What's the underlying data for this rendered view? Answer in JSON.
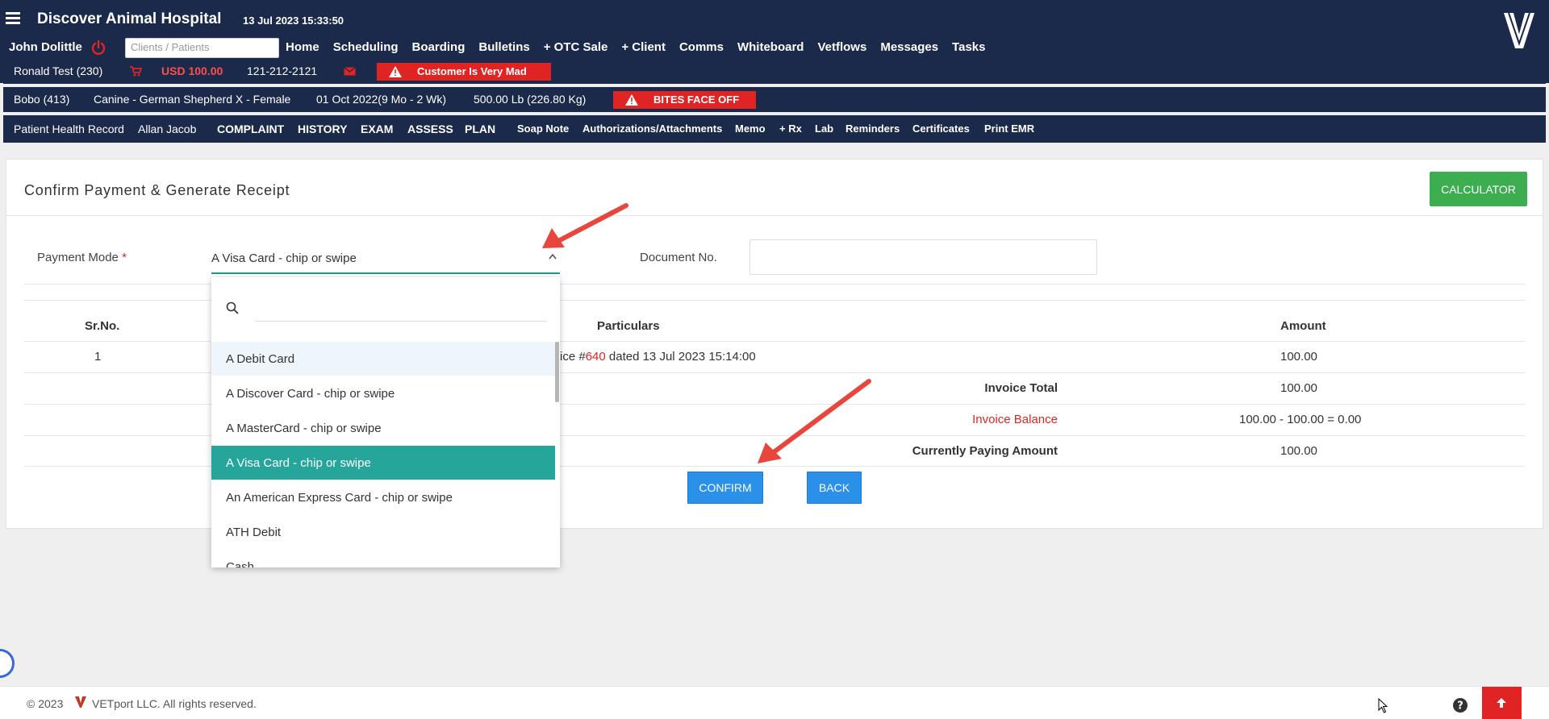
{
  "header": {
    "clinic_name": "Discover Animal Hospital",
    "datetime": "13 Jul 2023 15:33:50",
    "user_name": "John Dolittle",
    "search_placeholder": "Clients / Patients",
    "nav": [
      "Home",
      "Scheduling",
      "Boarding",
      "Bulletins",
      "+ OTC Sale",
      "+ Client",
      "Comms",
      "Whiteboard",
      "Vetflows",
      "Messages",
      "Tasks"
    ]
  },
  "client": {
    "name": "Ronald Test (230)",
    "balance": "USD 100.00",
    "phone": "121-212-2121",
    "alert": "Customer Is Very Mad"
  },
  "patient": {
    "name": "Bobo (413)",
    "breed": "Canine - German Shepherd X - Female",
    "dob": "01 Oct 2022(9 Mo - 2 Wk)",
    "weight": "500.00 Lb (226.80 Kg)",
    "alert": "BITES FACE OFF"
  },
  "record_bar": {
    "title": "Patient Health Record",
    "doctor": "Allan Jacob",
    "tabs": [
      "COMPLAINT",
      "HISTORY",
      "EXAM",
      "ASSESS",
      "PLAN",
      "Soap Note",
      "Authorizations/Attachments",
      "Memo",
      "+ Rx",
      "Lab",
      "Reminders",
      "Certificates",
      "Print EMR"
    ]
  },
  "page": {
    "title": "Confirm Payment & Generate Receipt",
    "calculator_label": "CALCULATOR"
  },
  "form": {
    "payment_mode_label": "Payment Mode",
    "required_mark": "*",
    "payment_mode_value": "A Visa Card - chip or swipe",
    "document_no_label": "Document No.",
    "document_no_value": ""
  },
  "table": {
    "headers": {
      "srno": "Sr.No.",
      "particulars": "Particulars",
      "amount": "Amount"
    },
    "rows": [
      {
        "srno": "1",
        "particular_prefix": "ice #",
        "invoice_no": "640",
        "particular_suffix": " dated 13 Jul 2023 15:14:00",
        "amount": "100.00"
      }
    ],
    "summary": [
      {
        "label": "Invoice Total",
        "value": "100.00"
      },
      {
        "label": "Invoice Balance",
        "value": "100.00 - 100.00 = 0.00"
      },
      {
        "label": "Currently Paying Amount",
        "value": "100.00"
      }
    ]
  },
  "buttons": {
    "confirm": "CONFIRM",
    "back": "BACK"
  },
  "dropdown": {
    "options": [
      "A Debit Card",
      "A Discover Card - chip or swipe",
      "A MasterCard - chip or swipe",
      "A Visa Card - chip or swipe",
      "An American Express Card - chip or swipe",
      "ATH Debit",
      "Cash"
    ],
    "selected": "A Visa Card - chip or swipe",
    "search_value": ""
  },
  "footer": {
    "copyright": "© 2023",
    "company": "VETport LLC. All rights reserved."
  },
  "colors": {
    "header_bg": "#1b2a4a",
    "alert_red": "#e02424",
    "accent_teal": "#26a69a",
    "confirm_blue": "#2b90e8",
    "calculator_green": "#3cae4f",
    "annotation_arrow": "#e8453c"
  }
}
